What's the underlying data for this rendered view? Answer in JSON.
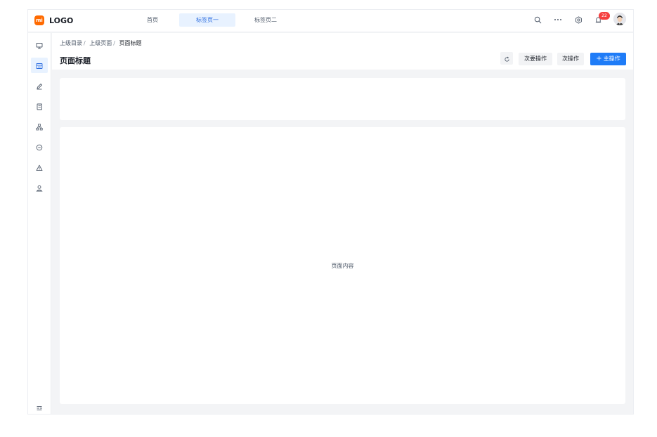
{
  "header": {
    "logo_mark": "mi",
    "logo_text": "LOGO",
    "tabs": [
      {
        "label": "首页",
        "active": false
      },
      {
        "label": "标签页一",
        "active": true
      },
      {
        "label": "标签页二",
        "active": false
      }
    ],
    "tools": [
      "search-icon",
      "more-icon",
      "settings-icon",
      "notification-icon"
    ],
    "notification_count": "22",
    "avatar": "user-avatar"
  },
  "sidebar": {
    "items": [
      {
        "icon": "monitor-icon",
        "active": false
      },
      {
        "icon": "document-list-icon",
        "active": true
      },
      {
        "icon": "edit-icon",
        "active": false
      },
      {
        "icon": "file-icon",
        "active": false
      },
      {
        "icon": "org-chart-icon",
        "active": false
      },
      {
        "icon": "minus-circle-icon",
        "active": false
      },
      {
        "icon": "warning-icon",
        "active": false
      },
      {
        "icon": "user-icon",
        "active": false
      }
    ],
    "collapse_icon": "collapse-icon"
  },
  "page": {
    "breadcrumb": [
      "上级目录",
      "上级页面",
      "页面标题"
    ],
    "breadcrumb_separator": "/",
    "title": "页面标题",
    "actions": {
      "refresh_icon": "refresh-icon",
      "secondary_label": "次要操作",
      "tertiary_label": "次操作",
      "primary_icon": "plus-icon",
      "primary_label": "主操作"
    },
    "content_placeholder": "页面内容"
  },
  "colors": {
    "brand": "#ff6a00",
    "primary": "#1f7cf7",
    "active_tab_bg": "#e8f2ff",
    "badge": "#f53f3f",
    "page_bg": "#f3f4f6"
  }
}
